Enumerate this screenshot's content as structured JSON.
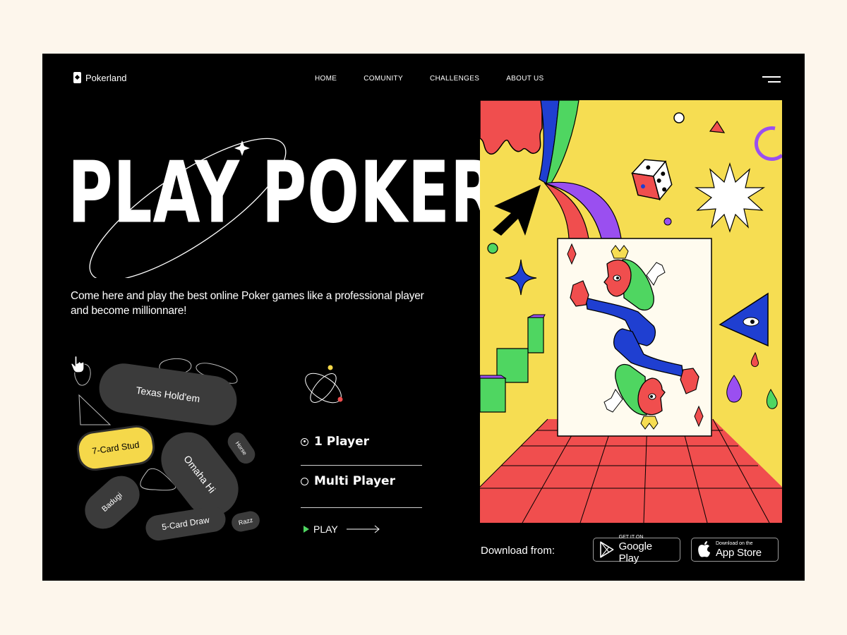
{
  "brand": {
    "name": "Pokerland"
  },
  "nav": {
    "items": [
      "HOME",
      "COMUNITY",
      "CHALLENGES",
      "ABOUT US"
    ]
  },
  "hero": {
    "title": "PLAY POKER",
    "description": "Come here and play the best online Poker games like a professional player and become millionnare!"
  },
  "games": {
    "texas": "Texas Hold'em",
    "stud": "7-Card Stud",
    "omaha": "Omaha Hi",
    "horse": "Horse",
    "badugi": "Badugi",
    "five_card": "5-Card Draw",
    "razz": "Razz",
    "selected": "7-Card Stud"
  },
  "modes": {
    "one_player": "1 Player",
    "multi_player": "Multi Player",
    "selected": "1 Player"
  },
  "play": {
    "label": "PLAY"
  },
  "download": {
    "label": "Download from:",
    "google_small": "GET IT ON",
    "google_big": "Google Play",
    "apple_small": "Download on the",
    "apple_big": "App Store"
  },
  "colors": {
    "background": "#fdf6ec",
    "frame": "#000000",
    "accent_yellow": "#f5d84a",
    "pill_gray": "#3b3b3b",
    "play_green": "#4fd661",
    "art_yellow": "#f6dd52",
    "art_red": "#f04e4e",
    "art_blue": "#1f3fd1",
    "art_green": "#4fd661",
    "art_purple": "#9a4ff0"
  },
  "icons": [
    "card-diamond-logo-icon",
    "menu-icon",
    "orbit-sparkle-icon",
    "atom-icon",
    "hand-cursor-icon",
    "play-triangle-icon",
    "arrow-right-icon",
    "google-play-icon",
    "apple-icon"
  ]
}
